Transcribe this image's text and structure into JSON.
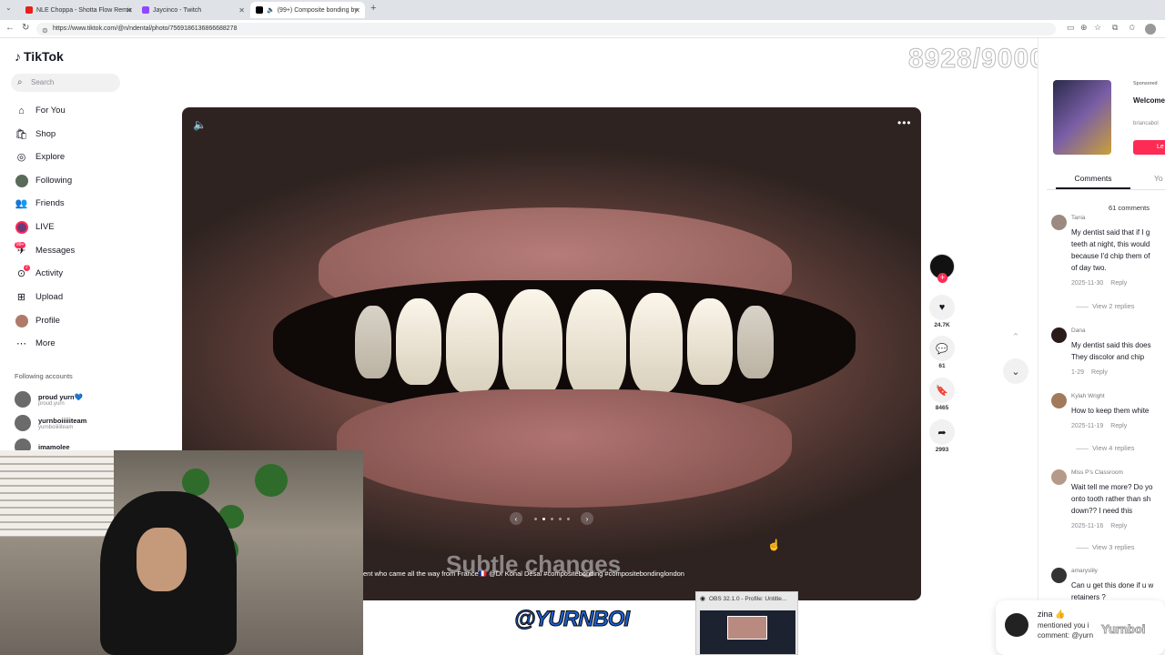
{
  "browser": {
    "tabs": [
      {
        "title": "NLE Choppa - Shotta Flow Remix",
        "color": "#e62117"
      },
      {
        "title": "Jaycinco - Twitch",
        "color": "#9146ff"
      },
      {
        "title": "(99+) Composite bonding by",
        "color": "#000000"
      }
    ],
    "url": "https://www.tiktok.com/@n/ndental/photo/7569186136866688278"
  },
  "sidebar": {
    "logo": "TikTok",
    "search_placeholder": "Search",
    "nav": [
      {
        "label": "For You",
        "icon": "home-icon"
      },
      {
        "label": "Shop",
        "icon": "shop-icon"
      },
      {
        "label": "Explore",
        "icon": "compass-icon"
      },
      {
        "label": "Following",
        "icon": "following-avatar-icon"
      },
      {
        "label": "Friends",
        "icon": "friends-icon"
      },
      {
        "label": "LIVE",
        "icon": "live-icon"
      },
      {
        "label": "Messages",
        "icon": "messages-icon",
        "badge": "99+"
      },
      {
        "label": "Activity",
        "icon": "activity-icon",
        "badge": "2"
      },
      {
        "label": "Upload",
        "icon": "upload-icon"
      },
      {
        "label": "Profile",
        "icon": "profile-avatar-icon"
      },
      {
        "label": "More",
        "icon": "more-dots-icon"
      }
    ],
    "following_title": "Following accounts",
    "accounts": [
      {
        "name": "proud yurn💙",
        "handle": "proud.yurn"
      },
      {
        "name": "yurnboiiiiiteam",
        "handle": "yurnboiiiiiteam"
      },
      {
        "name": "imamolee",
        "handle": ""
      }
    ]
  },
  "video": {
    "overlay_text": "Subtle changes",
    "caption": "ent who came all the way from France🇫🇷 @Dr Konal Desai #compositebonding #compositebondinglondon",
    "slide_index": 2,
    "slide_total": 5
  },
  "actions": {
    "likes": "24.7K",
    "comments": "61",
    "saves": "8465",
    "shares": "2993"
  },
  "counter": "8928/9000",
  "ad": {
    "sponsored": "Sponsored",
    "title": "Welcome the life o",
    "handle": "briancabol",
    "button": "Le"
  },
  "comments_panel": {
    "tab_comments": "Comments",
    "tab_you": "Yo",
    "count_label": "61 comments",
    "items": [
      {
        "user": "Tania",
        "lines": [
          "My dentist said that if I g",
          "teeth at night, this would",
          "because I'd chip them of",
          "of day two."
        ],
        "date": "2025-11-30",
        "reply": "Reply",
        "view_replies": "View 2 replies"
      },
      {
        "user": "Dana",
        "lines": [
          "My dentist said this does",
          "They discolor and chip"
        ],
        "date": "1-29",
        "reply": "Reply"
      },
      {
        "user": "Kylah Wright",
        "lines": [
          "How to keep them white"
        ],
        "date": "2025-11-19",
        "reply": "Reply",
        "view_replies": "View 4 replies"
      },
      {
        "user": "Miss P's Classroom",
        "lines": [
          "Wait tell me more? Do yo",
          "onto tooth rather than sh",
          "down?? I need this"
        ],
        "date": "2025-11-16",
        "reply": "Reply",
        "view_replies": "View 3 replies"
      },
      {
        "user": "amaryslily",
        "lines": [
          "Can u get this done if u w",
          "retainers ?"
        ]
      }
    ]
  },
  "stream": {
    "banner": "@YURNBOI",
    "obs_title": "OBS 32.1.0 - Profile: Untitle...",
    "watermark": "Yurnboi"
  },
  "notification": {
    "name": "zina 👍",
    "line2": "mentioned you i",
    "line3": "comment: @yurn"
  }
}
